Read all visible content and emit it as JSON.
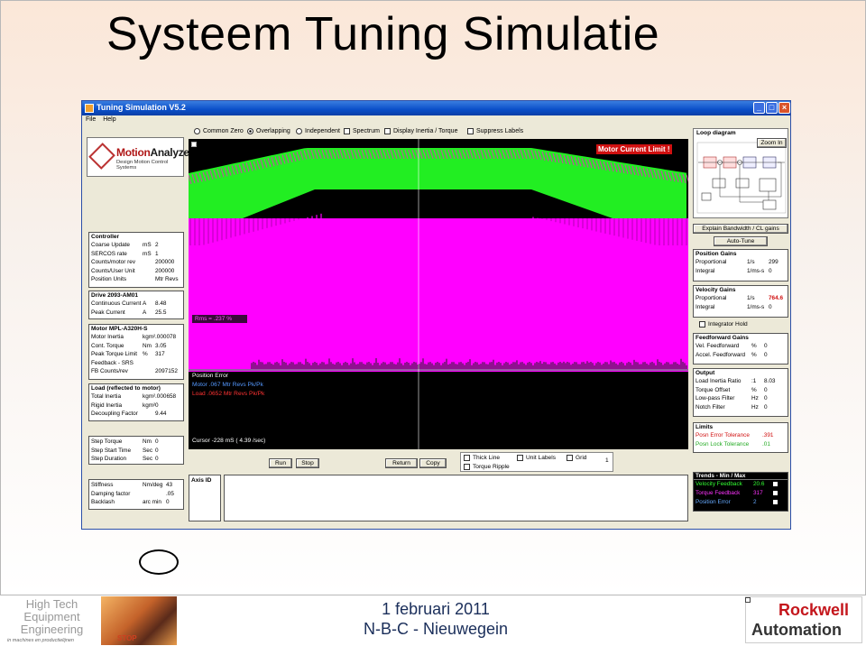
{
  "slide": {
    "title": "Systeem Tuning Simulatie",
    "footer_date": "1 februari 2011",
    "footer_place": "N-B-C - Nieuwegein",
    "left_logo_lines": [
      "High Tech",
      "Equipment",
      "Engineering"
    ],
    "left_logo_sub": "in machines en productielijnen",
    "photo_text": "STOP",
    "right_logo_line1": "Rockwell",
    "right_logo_line2": "Automation"
  },
  "window": {
    "title": "Tuning Simulation V5.2",
    "menu": [
      "File",
      "Help"
    ],
    "controls": {
      "minimize": "_",
      "maximize": "□",
      "close": "×"
    }
  },
  "toolbar": {
    "radios": [
      {
        "label": "Common Zero",
        "selected": false
      },
      {
        "label": "Overlapping",
        "selected": true
      },
      {
        "label": "Independent",
        "selected": false
      }
    ],
    "checks": [
      {
        "label": "Spectrum",
        "checked": false
      },
      {
        "label": "Display Inertia / Torque",
        "checked": false
      },
      {
        "label": "Suppress Labels",
        "checked": false
      }
    ]
  },
  "logo": {
    "name": "MotionAnalyzer",
    "name_a": "Motion",
    "name_b": "Analyzer",
    "tagline": "Design Motion Control Systems"
  },
  "controller": {
    "header": "Controller",
    "rows": [
      {
        "k": "Coarse Update",
        "u": "mS",
        "v": "2"
      },
      {
        "k": "SERCOS  rate",
        "u": "mS",
        "v": "1"
      },
      {
        "k": "Counts/motor rev",
        "u": "",
        "v": "200000"
      },
      {
        "k": "Counts/User Unit",
        "u": "",
        "v": "200000"
      },
      {
        "k": "Position Units",
        "u": "",
        "v": "Mtr Revs"
      }
    ]
  },
  "drive": {
    "header": "Drive 2093-AM01",
    "rows": [
      {
        "k": "Continuous Current",
        "u": "A",
        "v": "8.48"
      },
      {
        "k": "Peak Current",
        "u": "A",
        "v": "25.5"
      }
    ]
  },
  "motor": {
    "header": "Motor MPL-A320H-S",
    "rows": [
      {
        "k": "Motor Inertia",
        "u": "kgm²",
        "v": ".000078"
      },
      {
        "k": "Cont. Torque",
        "u": "Nm",
        "v": "3.05"
      },
      {
        "k": "Peak Torque Limit",
        "u": "%",
        "v": "317"
      },
      {
        "k": "Feedback - SRS",
        "u": "",
        "v": ""
      },
      {
        "k": "FB Counts/rev",
        "u": "",
        "v": "2097152"
      }
    ]
  },
  "load": {
    "header": "Load (reflected to motor)",
    "rows": [
      {
        "k": "Total Inertia",
        "u": "kgm²",
        "v": ".000658"
      },
      {
        "k": "Rigid Inertia",
        "u": "kgm²",
        "v": "0"
      },
      {
        "k": "Decoupling Factor",
        "u": "",
        "v": "9.44"
      }
    ]
  },
  "step": {
    "rows": [
      {
        "k": "Step Torque",
        "u": "Nm",
        "v": "0"
      },
      {
        "k": "Step Start Time",
        "u": "Sec",
        "v": "0"
      },
      {
        "k": "Step Duration",
        "u": "Sec",
        "v": "0"
      }
    ]
  },
  "mechanics": {
    "rows": [
      {
        "k": "Stiffness",
        "u": "Nm/deg",
        "v": "43"
      },
      {
        "k": "Damping factor",
        "u": "",
        "v": ".05"
      },
      {
        "k": "Backlash",
        "u": "arc min",
        "v": "0"
      }
    ]
  },
  "scope": {
    "warning": "Motor Current Limit !",
    "rms": "Rms = .237 %",
    "legend_title": "Position Error",
    "legend_motor": "Motor  .067 Mtr Revs Pk/Pk",
    "legend_load": "Load  .0652 Mtr Revs Pk/Pk",
    "cursor": "Cursor -228 mS ( 4.39 /sec)",
    "colors": {
      "velocity": "#22ee22",
      "torque": "#ff00ff",
      "torque_stripes": "#cc00cc",
      "motor_text": "#5599ff",
      "load_text": "#ff3333",
      "legend_title": "#ffffff"
    }
  },
  "buttons": {
    "run": "Run",
    "stop": "Stop",
    "return": "Return",
    "copy": "Copy"
  },
  "display_options": {
    "thick_line": "Thick Line",
    "unit_labels": "Unit Labels",
    "grid": "Grid",
    "torque_ripple": "Torque Ripple",
    "page": "1"
  },
  "axis_label": "Axis ID",
  "loop": {
    "header": "Loop diagram",
    "zoom": "Zoom In",
    "explain": "Explain Bandwidth / CL gains",
    "autotune": "Auto-Tune"
  },
  "position_gains": {
    "header": "Position Gains",
    "rows": [
      {
        "k": "Proportional",
        "u": "1/s",
        "v": "299"
      },
      {
        "k": "Integral",
        "u": "1/ms-s",
        "v": "0"
      }
    ]
  },
  "velocity_gains": {
    "header": "Velocity Gains",
    "rows": [
      {
        "k": "Proportional",
        "u": "1/s",
        "v": "764.6"
      },
      {
        "k": "Integral",
        "u": "1/ms-s",
        "v": "0"
      }
    ],
    "highlight_color": "#d01010"
  },
  "integrator_hold": "Integrator Hold",
  "feedforward": {
    "header": "Feedforward Gains",
    "rows": [
      {
        "k": "Vel. Feedforward",
        "u": "%",
        "v": "0"
      },
      {
        "k": "Accel. Feedforward",
        "u": "%",
        "v": "0"
      }
    ]
  },
  "output": {
    "header": "Output",
    "rows": [
      {
        "k": "Load Inertia Ratio",
        "u": ":1",
        "v": "8.03"
      },
      {
        "k": "Torque Offset",
        "u": "%",
        "v": "0"
      },
      {
        "k": "Low-pass Filter",
        "u": "Hz",
        "v": "0"
      },
      {
        "k": "Notch Filter",
        "u": "Hz",
        "v": "0"
      }
    ]
  },
  "limits": {
    "header": "Limits",
    "rows": [
      {
        "k": "Posn Error Tolerance",
        "v": ".391"
      },
      {
        "k": "Posn Lock Tolerance",
        "v": ".01"
      }
    ],
    "colors": {
      "error": "#d01010",
      "lock": "#22aa22"
    }
  },
  "trends": {
    "header": "Trends - Min / Max",
    "rows": [
      {
        "label": "Velocity Feedback",
        "value": "20.6",
        "color": "#33ff33"
      },
      {
        "label": "Torque Feedback",
        "value": "317",
        "color": "#ff33ff"
      },
      {
        "label": "Position Error",
        "value": "2",
        "color": "#66aaff"
      }
    ]
  }
}
